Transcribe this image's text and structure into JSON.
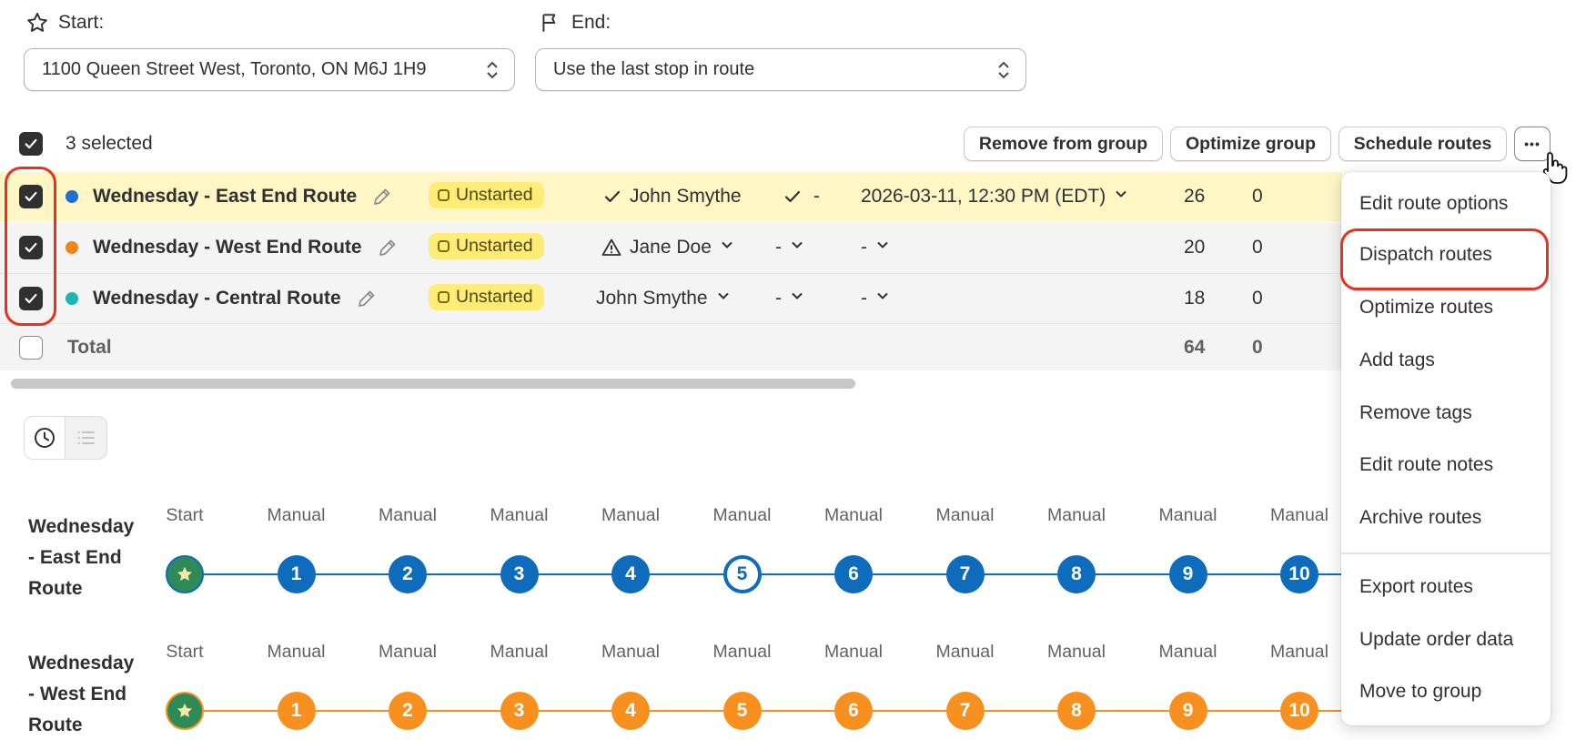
{
  "start": {
    "label": "Start:",
    "value": "1100 Queen Street West, Toronto, ON M6J 1H9"
  },
  "end": {
    "label": "End:",
    "value": "Use the last stop in route"
  },
  "bulk": {
    "selected_text": "3 selected",
    "buttons": [
      "Remove from group",
      "Optimize group",
      "Schedule routes"
    ],
    "more_label": "•••"
  },
  "routes": [
    {
      "name": "Wednesday - East End Route",
      "color": "#1f6fcf",
      "status": "Unstarted",
      "driver": "John Smythe",
      "vehicle": "-",
      "time": "2026-03-11, 12:30 PM (EDT)",
      "stops": "26",
      "done": "0"
    },
    {
      "name": "Wednesday - West End Route",
      "color": "#f0861a",
      "status": "Unstarted",
      "driver": "Jane Doe",
      "vehicle": "-",
      "time": "-",
      "stops": "20",
      "done": "0"
    },
    {
      "name": "Wednesday - Central Route",
      "color": "#19b8b0",
      "status": "Unstarted",
      "driver": "John Smythe",
      "vehicle": "-",
      "time": "-",
      "stops": "18",
      "done": "0"
    }
  ],
  "total": {
    "label": "Total",
    "stops": "64",
    "done": "0"
  },
  "timeline": {
    "start_label": "Start",
    "stop_label": "Manual",
    "rows": [
      {
        "name_lines": [
          "Wednesday",
          "- East End",
          "Route"
        ],
        "color": "#0f6cbd",
        "stops": [
          "1",
          "2",
          "3",
          "4",
          "5",
          "6",
          "7",
          "8",
          "9",
          "10"
        ],
        "outlined_stop": "5"
      },
      {
        "name_lines": [
          "Wednesday",
          "- West End",
          "Route"
        ],
        "color": "#f7901e",
        "stops": [
          "1",
          "2",
          "3",
          "4",
          "5",
          "6",
          "7",
          "8",
          "9",
          "10"
        ]
      }
    ]
  },
  "menu": {
    "items": [
      "Edit route options",
      "Dispatch routes",
      "Optimize routes",
      "Add tags",
      "Remove tags",
      "Edit route notes",
      "Archive routes"
    ],
    "items2": [
      "Export routes",
      "Update order data",
      "Move to group"
    ],
    "highlighted": "Dispatch routes"
  }
}
